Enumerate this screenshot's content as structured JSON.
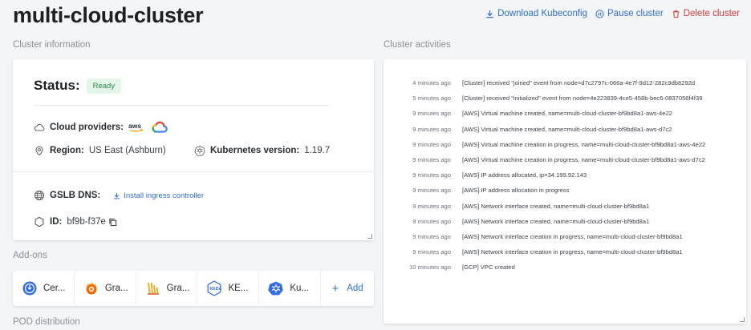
{
  "header": {
    "title": "multi-cloud-cluster",
    "download_label": "Download Kubeconfig",
    "pause_label": "Pause cluster",
    "delete_label": "Delete cluster"
  },
  "sections": {
    "cluster_info": "Cluster information",
    "cluster_activities": "Cluster activities",
    "addons": "Add-ons",
    "pod_distribution": "POD distribution"
  },
  "info": {
    "status_label": "Status:",
    "status_value": "Ready",
    "cloud_providers_label": "Cloud providers:",
    "region_label": "Region:",
    "region_value": "US East (Ashburn)",
    "k8s_label": "Kubernetes version:",
    "k8s_value": "1.19.7",
    "gslb_label": "GSLB DNS:",
    "install_ingress": "Install ingress controller",
    "id_label": "ID:",
    "id_value": "bf9b-f37e"
  },
  "addons": [
    {
      "label": "Cer...",
      "icon": "cert-manager-icon"
    },
    {
      "label": "Gra...",
      "icon": "grafana-icon"
    },
    {
      "label": "Gra...",
      "icon": "grafana-loki-icon"
    },
    {
      "label": "KE...",
      "icon": "keda-icon"
    },
    {
      "label": "Ku...",
      "icon": "kubernetes-icon"
    },
    {
      "label": "Add",
      "icon": "plus-icon"
    }
  ],
  "activities": [
    {
      "time": "4 minutes ago",
      "msg": "[Cluster] received \"joined\" event from node=d7c2797c-066a-4e7f-9d12-282c9db8292d"
    },
    {
      "time": "5 minutes ago",
      "msg": "[Cluster] received \"initialized\" event from node=4e223839-4ce5-458b-bec6-0837056f4f39"
    },
    {
      "time": "9 minutes ago",
      "msg": "[AWS] Virtual machine created, name=multi-cloud-cluster-bf9bd8a1-aws-4e22"
    },
    {
      "time": "9 minutes ago",
      "msg": "[AWS] Virtual machine created, name=multi-cloud-cluster-bf9bd8a1-aws-d7c2"
    },
    {
      "time": "9 minutes ago",
      "msg": "[AWS] Virtual machine creation in progress, name=multi-cloud-cluster-bf9bd8a1-aws-4e22"
    },
    {
      "time": "9 minutes ago",
      "msg": "[AWS] Virtual machine creation in progress, name=multi-cloud-cluster-bf9bd8a1-aws-d7c2"
    },
    {
      "time": "9 minutes ago",
      "msg": "[AWS] IP address allocated, ip=34.199.92.143"
    },
    {
      "time": "9 minutes ago",
      "msg": "[AWS] IP address allocation in progress"
    },
    {
      "time": "9 minutes ago",
      "msg": "[AWS] Network interface created, name=multi-cloud-cluster-bf9bd8a1"
    },
    {
      "time": "9 minutes ago",
      "msg": "[AWS] Network interface created, name=multi-cloud-cluster-bf9bd8a1"
    },
    {
      "time": "9 minutes ago",
      "msg": "[AWS] Network interface creation in progress, name=multi-cloud-cluster-bf9bd8a1"
    },
    {
      "time": "9 minutes ago",
      "msg": "[AWS] Network interface creation in progress, name=multi-cloud-cluster-bf9bd8a1"
    },
    {
      "time": "10 minutes ago",
      "msg": "[GCP] VPC created"
    }
  ],
  "colors": {
    "accent": "#2f6fd6",
    "danger": "#d23a3a",
    "ready_bg": "#e4f5ea",
    "ready_fg": "#2e8a4e"
  }
}
